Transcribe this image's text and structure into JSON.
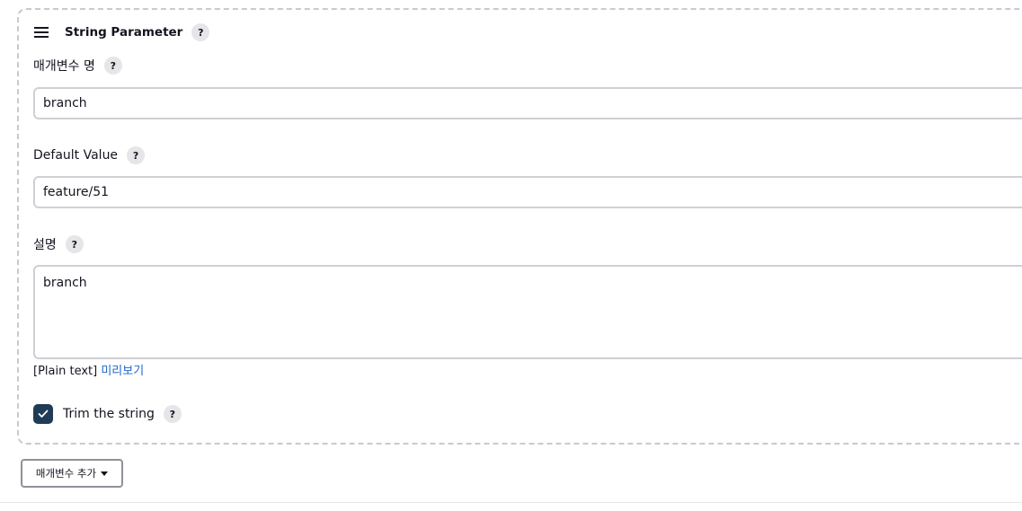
{
  "parameter": {
    "title": "String Parameter",
    "help_label": "?",
    "name_label": "매개변수 명",
    "name_value": "branch",
    "default_label": "Default Value",
    "default_value": "feature/51",
    "description_label": "설명",
    "description_value": "branch",
    "format_text": "[Plain text]",
    "preview_link": "미리보기",
    "trim_label": "Trim the string",
    "trim_checked": true
  },
  "add_button": {
    "label": "매개변수 추가"
  },
  "icons": {
    "drag": "hamburger-drag-icon",
    "help": "question-help-icon",
    "check": "checkmark-icon",
    "caret": "caret-down-icon"
  },
  "colors": {
    "checkbox_fill": "#1f3b56",
    "link": "#1d65c9",
    "border": "#cfcfd5",
    "help_bg": "#e6e6e9"
  }
}
